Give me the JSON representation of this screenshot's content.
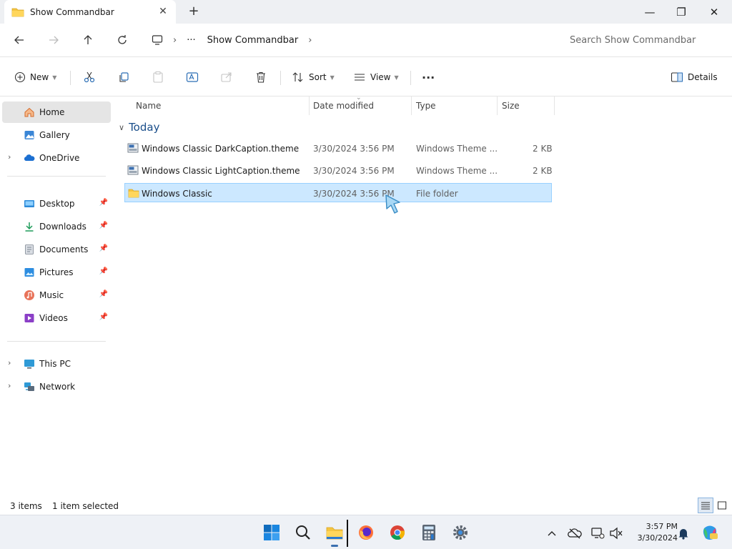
{
  "window": {
    "tab_title": "Show Commandbar",
    "new_tab": "+",
    "minimize": "—",
    "maximize": "❐",
    "close": "✕"
  },
  "address": {
    "more": "···",
    "crumb": "Show Commandbar",
    "search_placeholder": "Search Show Commandbar"
  },
  "commandbar": {
    "new_label": "New",
    "sort_label": "Sort",
    "view_label": "View",
    "more": "···",
    "details_label": "Details"
  },
  "nav": {
    "home": "Home",
    "gallery": "Gallery",
    "onedrive": "OneDrive",
    "desktop": "Desktop",
    "downloads": "Downloads",
    "documents": "Documents",
    "pictures": "Pictures",
    "music": "Music",
    "videos": "Videos",
    "thispc": "This PC",
    "network": "Network"
  },
  "columns": {
    "name": "Name",
    "date": "Date modified",
    "type": "Type",
    "size": "Size"
  },
  "group_label": "Today",
  "files": [
    {
      "name": "Windows Classic DarkCaption.theme",
      "date": "3/30/2024 3:56 PM",
      "type": "Windows Theme ...",
      "size": "2 KB",
      "kind": "theme"
    },
    {
      "name": "Windows Classic LightCaption.theme",
      "date": "3/30/2024 3:56 PM",
      "type": "Windows Theme ...",
      "size": "2 KB",
      "kind": "theme"
    },
    {
      "name": "Windows Classic",
      "date": "3/30/2024 3:56 PM",
      "type": "File folder",
      "size": "",
      "kind": "folder",
      "selected": true
    }
  ],
  "status": {
    "item_count": "3 items",
    "selection": "1 item selected"
  },
  "clock": {
    "time": "3:57 PM",
    "date": "3/30/2024"
  },
  "colors": {
    "selection_bg": "#cce8ff",
    "selection_border": "#99d1ff",
    "accent": "#0067c0",
    "folder": "#f4c542"
  },
  "icons": [
    "folder-icon",
    "back-arrow-icon",
    "forward-arrow-icon",
    "up-arrow-icon",
    "refresh-icon",
    "monitor-icon",
    "plus-circle-icon",
    "cut-icon",
    "copy-icon",
    "paste-icon",
    "rename-icon",
    "share-icon",
    "delete-icon",
    "sort-icon",
    "view-icon",
    "details-pane-icon",
    "home-icon",
    "gallery-icon",
    "cloud-icon",
    "pin-icon",
    "windows-start-icon",
    "search-icon",
    "firefox-icon",
    "chrome-icon",
    "calculator-icon",
    "settings-icon",
    "bell-icon"
  ]
}
